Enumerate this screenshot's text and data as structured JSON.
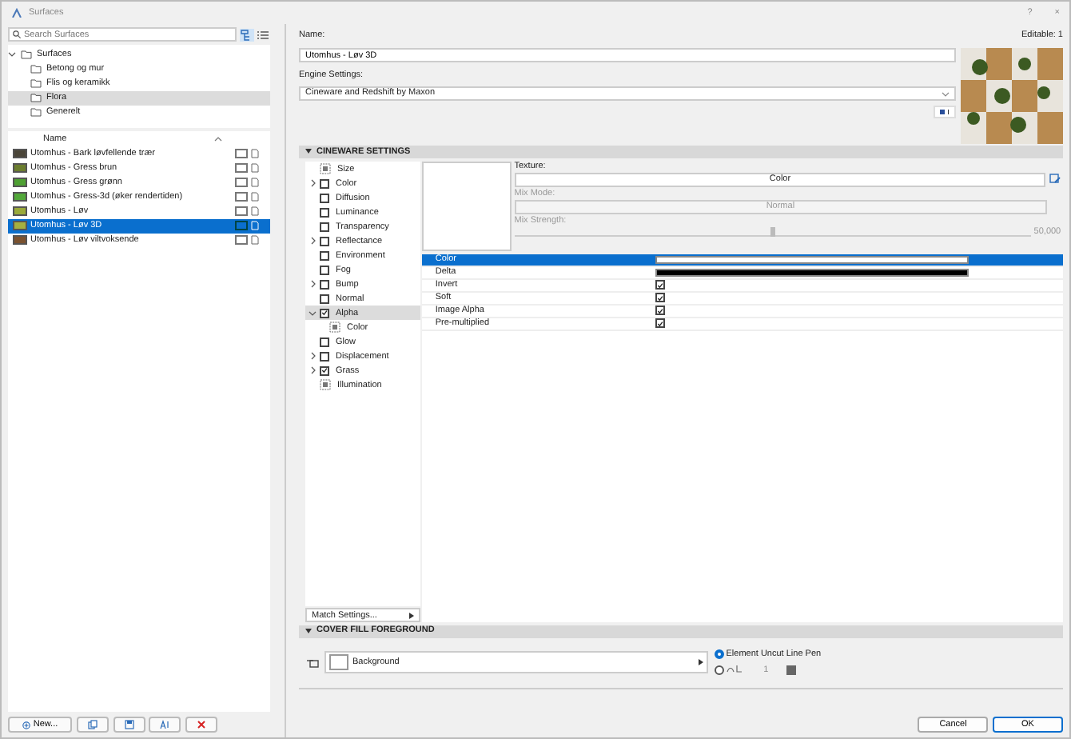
{
  "window": {
    "title": "Surfaces",
    "help": "?",
    "close": "×"
  },
  "search": {
    "placeholder": "Search Surfaces"
  },
  "tree": {
    "label": "Surfaces",
    "expanded": true,
    "children": [
      {
        "label": "Betong og mur",
        "selected": false
      },
      {
        "label": "Flis og keramikk",
        "selected": false
      },
      {
        "label": "Flora",
        "selected": true
      },
      {
        "label": "Generelt",
        "selected": false
      }
    ]
  },
  "list": {
    "column": "Name",
    "rows": [
      {
        "name": "Utomhus - Bark løvfellende trær",
        "color": "#4a4538",
        "selected": false
      },
      {
        "name": "Utomhus - Gress brun",
        "color": "#6b7d2e",
        "selected": false
      },
      {
        "name": "Utomhus - Gress grønn",
        "color": "#4ea032",
        "selected": false
      },
      {
        "name": "Utomhus - Gress-3d (øker rendertiden)",
        "color": "#52a83a",
        "selected": false
      },
      {
        "name": "Utomhus - Løv",
        "color": "#9aaa3a",
        "selected": false
      },
      {
        "name": "Utomhus - Løv 3D",
        "color": "#a4b040",
        "selected": true
      },
      {
        "name": "Utomhus - Løv viltvoksende",
        "color": "#7a5230",
        "selected": false
      }
    ]
  },
  "new_button": "New...",
  "editable": "Editable: 1",
  "name_label": "Name:",
  "name_value": "Utomhus - Løv 3D",
  "engine_label": "Engine Settings:",
  "engine_value": "Cineware and Redshift by Maxon",
  "cineware": {
    "title": "CINEWARE SETTINGS",
    "expanded": true,
    "channels": [
      {
        "label": "Size",
        "kind": "icon",
        "selected": false
      },
      {
        "label": "Color",
        "kind": "checkbox",
        "checked": false,
        "expanded": false,
        "selected": false
      },
      {
        "label": "Diffusion",
        "kind": "checkbox",
        "checked": false,
        "selected": false
      },
      {
        "label": "Luminance",
        "kind": "checkbox",
        "checked": false,
        "selected": false
      },
      {
        "label": "Transparency",
        "kind": "checkbox",
        "checked": false,
        "selected": false
      },
      {
        "label": "Reflectance",
        "kind": "checkbox",
        "checked": false,
        "expanded": false,
        "selected": false
      },
      {
        "label": "Environment",
        "kind": "checkbox",
        "checked": false,
        "selected": false
      },
      {
        "label": "Fog",
        "kind": "checkbox",
        "checked": false,
        "selected": false
      },
      {
        "label": "Bump",
        "kind": "checkbox",
        "checked": false,
        "expanded": false,
        "selected": false
      },
      {
        "label": "Normal",
        "kind": "checkbox",
        "checked": false,
        "selected": false
      },
      {
        "label": "Alpha",
        "kind": "checkbox",
        "checked": true,
        "expanded": true,
        "selected": true,
        "children": [
          {
            "label": "Color",
            "kind": "icon",
            "selected": false
          }
        ]
      },
      {
        "label": "Glow",
        "kind": "checkbox",
        "checked": false,
        "selected": false
      },
      {
        "label": "Displacement",
        "kind": "checkbox",
        "checked": false,
        "expanded": false,
        "selected": false
      },
      {
        "label": "Grass",
        "kind": "checkbox",
        "checked": true,
        "expanded": false,
        "selected": false
      },
      {
        "label": "Illumination",
        "kind": "icon",
        "selected": false
      }
    ],
    "texture_label": "Texture:",
    "texture_value": "Color",
    "mix_mode_label": "Mix Mode:",
    "mix_mode_value": "Normal",
    "mix_strength_label": "Mix Strength:",
    "mix_strength": {
      "level": 0.5,
      "reading": "50,000"
    },
    "properties": [
      {
        "name": "Color",
        "kind": "color",
        "color": "#ffffff",
        "selected": true
      },
      {
        "name": "Delta",
        "kind": "color",
        "color": "#000000",
        "selected": false
      },
      {
        "name": "Invert",
        "kind": "checkbox",
        "checked": true,
        "selected": false
      },
      {
        "name": "Soft",
        "kind": "checkbox",
        "checked": true,
        "selected": false
      },
      {
        "name": "Image Alpha",
        "kind": "checkbox",
        "checked": true,
        "selected": false
      },
      {
        "name": "Pre-multiplied",
        "kind": "checkbox",
        "checked": true,
        "selected": false
      }
    ],
    "match_settings": "Match Settings..."
  },
  "cover_fill": {
    "title": "COVER FILL FOREGROUND",
    "expanded": true,
    "pen": "Background",
    "options": [
      {
        "label": "Element Uncut Line Pen",
        "selected": true
      },
      {
        "label": "1",
        "selected": false
      }
    ]
  },
  "buttons": [
    "Cancel",
    "OK"
  ]
}
